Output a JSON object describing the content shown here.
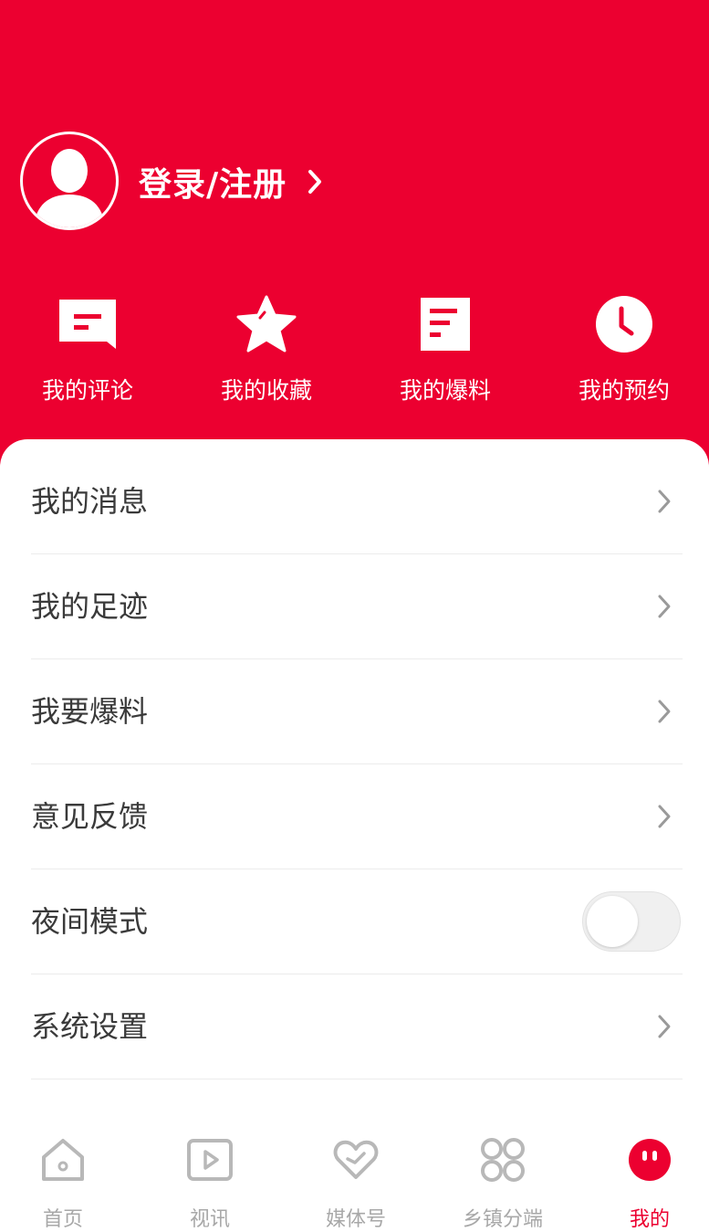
{
  "theme": {
    "accent": "#EC0030",
    "text": "#3a3a3a",
    "muted": "#a8a8a8"
  },
  "profile": {
    "login_label": "登录/注册",
    "avatar_icon": "user-silhouette-icon"
  },
  "quick_actions": [
    {
      "label": "我的评论",
      "icon": "comment-icon"
    },
    {
      "label": "我的收藏",
      "icon": "star-icon"
    },
    {
      "label": "我的爆料",
      "icon": "document-icon"
    },
    {
      "label": "我的预约",
      "icon": "clock-icon"
    }
  ],
  "menu": [
    {
      "label": "我的消息"
    },
    {
      "label": "我的足迹"
    },
    {
      "label": "我要爆料"
    },
    {
      "label": "意见反馈"
    },
    {
      "label": "夜间模式",
      "toggle": false
    },
    {
      "label": "系统设置"
    }
  ],
  "tabs": [
    {
      "label": "首页",
      "icon": "home-icon"
    },
    {
      "label": "视讯",
      "icon": "video-icon"
    },
    {
      "label": "媒体号",
      "icon": "heart-icon"
    },
    {
      "label": "乡镇分端",
      "icon": "grid-icon"
    },
    {
      "label": "我的",
      "icon": "profile-face-icon",
      "active": true
    }
  ]
}
